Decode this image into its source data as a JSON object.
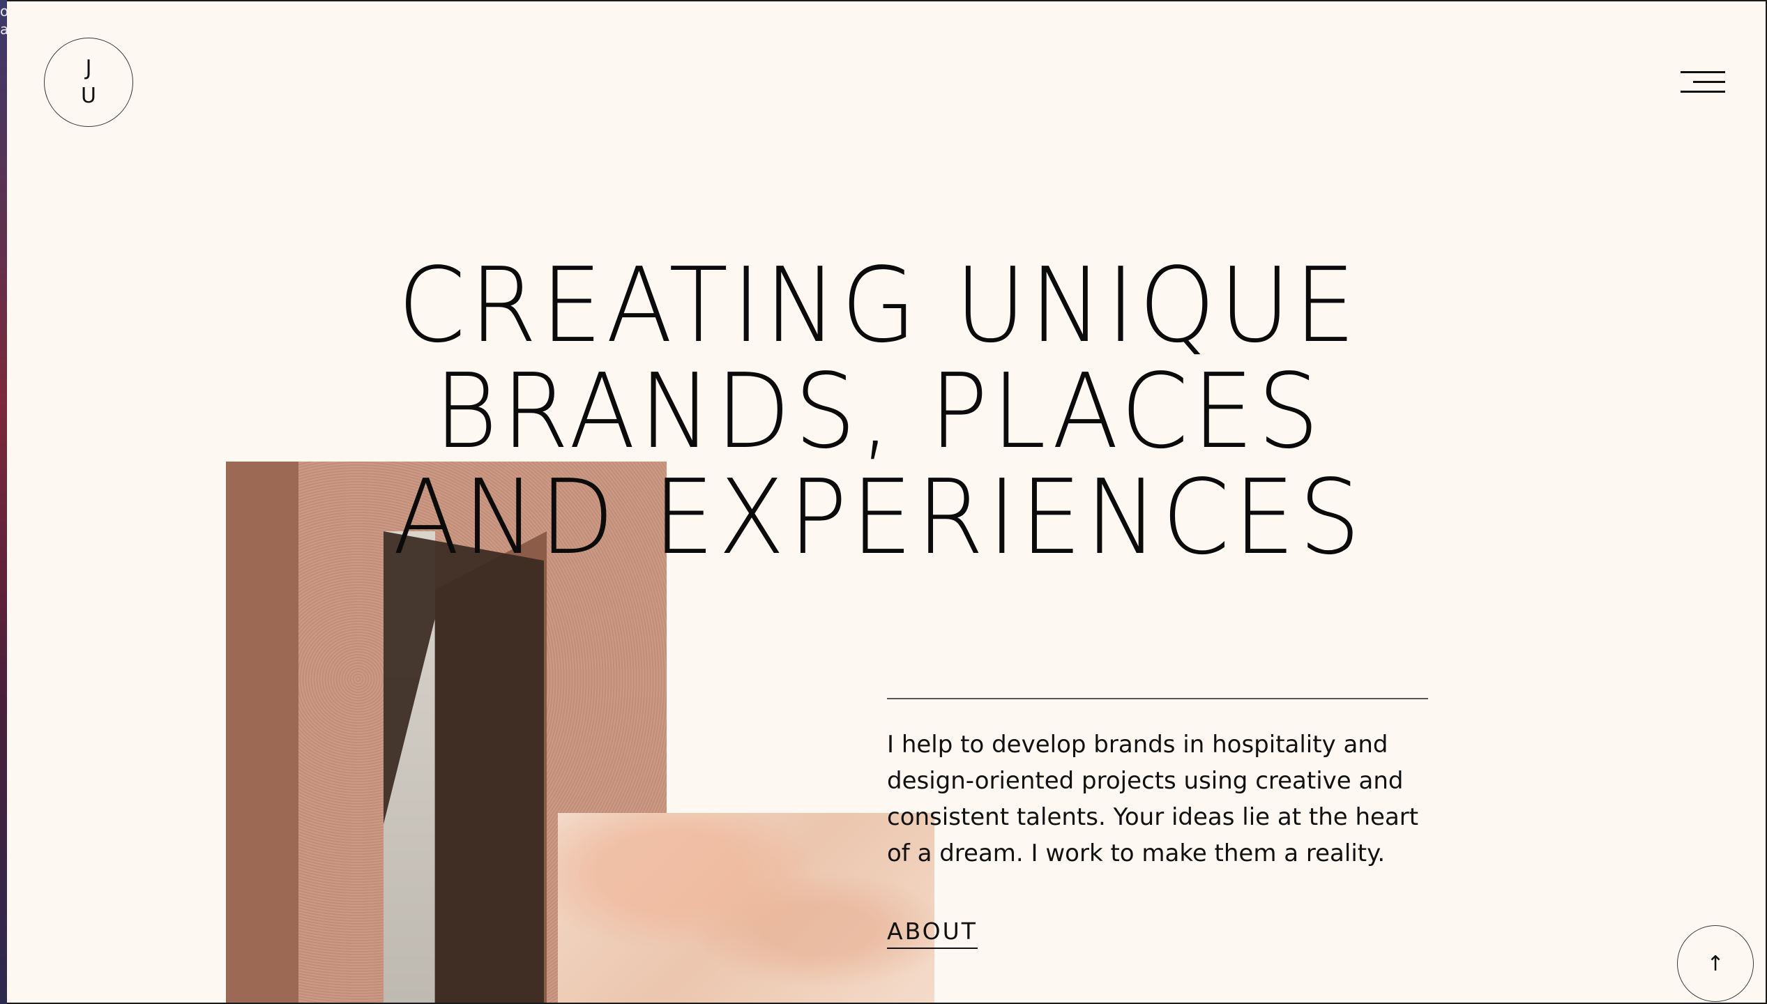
{
  "logo": {
    "line1": "J",
    "line2": "U"
  },
  "menu": {
    "icon": "hamburger-menu-icon"
  },
  "hero": {
    "headline_lines": [
      "CREATING UNIQUE",
      "BRANDS, PLACES",
      "AND EXPERIENCES"
    ],
    "intro_text": "I help to develop brands in hospitality and design-oriented projects using creative and consistent talents. Your ideas lie at the heart of a dream. I work to make them a reality.",
    "about_label": "ABOUT"
  },
  "images": {
    "tall_photo": "terracotta-wall-architecture-photo",
    "small_photo": "pink-plaster-texture-photo"
  },
  "scroll_top": {
    "icon": "arrow-up-icon",
    "glyph": "↑"
  },
  "edge_strip": {
    "glyph1": "o",
    "glyph2": "a"
  },
  "colors": {
    "background": "#fdf9f2",
    "text": "#0b0b0b",
    "terracotta": "#c9957e",
    "blush": "#f2d9c8"
  }
}
